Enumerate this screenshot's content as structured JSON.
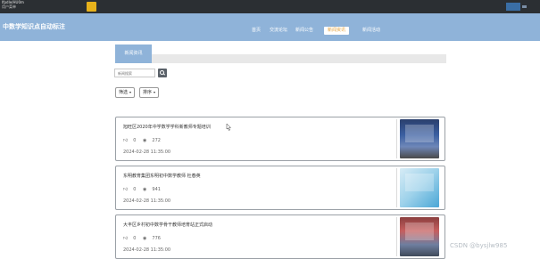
{
  "top_bar": {
    "line1": "lfpdle/HU0m",
    "line2": "用户菜单"
  },
  "header": {
    "title": "中数学知识点自动标注",
    "nav": [
      "首页",
      "交流论坛",
      "新闻公告",
      "新闻资讯",
      "新闻活动"
    ],
    "active_nav_index": 3
  },
  "section": {
    "tab_label": "新闻资讯"
  },
  "search": {
    "placeholder": "新闻搜索"
  },
  "filters": {
    "filter_label": "筛选",
    "sort_label": "排序"
  },
  "news": [
    {
      "title": "旭旺区2020年中学数学学科新教师专题培训",
      "likes": "0",
      "views": "272",
      "date": "2024-02-28 11:35:00",
      "thumb_icon": "classroom-photo"
    },
    {
      "title": "东明教育集团东明初中数学教师 杜春英",
      "likes": "0",
      "views": "941",
      "date": "2024-02-28 11:35:00",
      "thumb_icon": "infographic-photo"
    },
    {
      "title": "大丰区乡村初中数学骨干教师培育站正式启动",
      "likes": "0",
      "views": "776",
      "date": "2024-02-28 11:35:00",
      "thumb_icon": "meeting-photo"
    }
  ],
  "watermark": "CSDN @bysjlw985",
  "colors": {
    "header_blue": "#8fb3d9",
    "active_nav_text": "#e6a23c",
    "topbar": "#2b2f33"
  }
}
